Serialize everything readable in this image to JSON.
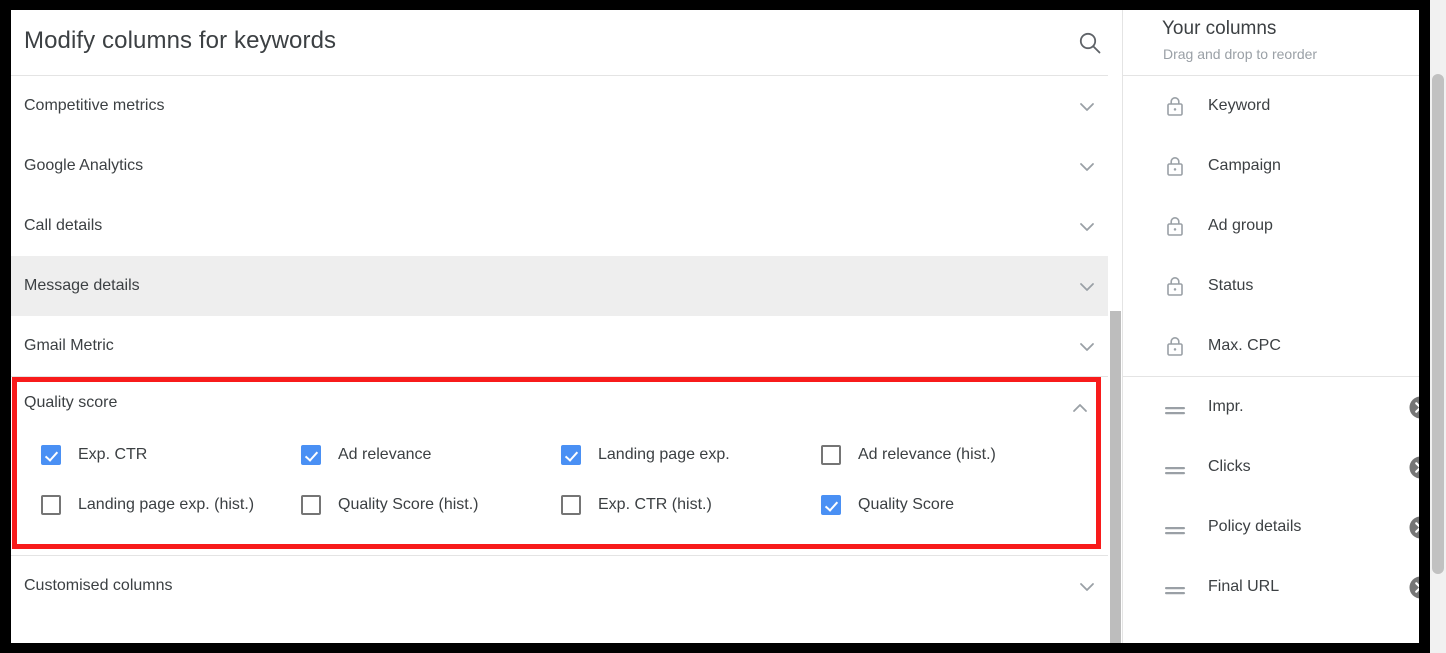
{
  "dialog": {
    "title": "Modify columns for keywords",
    "search_icon": "search-icon"
  },
  "sections": [
    {
      "label": "Competitive metrics",
      "expanded": false,
      "hovered": false
    },
    {
      "label": "Google Analytics",
      "expanded": false,
      "hovered": false
    },
    {
      "label": "Call details",
      "expanded": false,
      "hovered": false
    },
    {
      "label": "Message details",
      "expanded": false,
      "hovered": true
    },
    {
      "label": "Gmail Metric",
      "expanded": false,
      "hovered": false
    }
  ],
  "quality_score": {
    "label": "Quality score",
    "expanded": true,
    "highlight_color": "#f81b1b",
    "rows": [
      [
        {
          "label": "Exp. CTR",
          "checked": true
        },
        {
          "label": "Ad relevance",
          "checked": true
        },
        {
          "label": "Landing page exp.",
          "checked": true
        },
        {
          "label": "Ad relevance (hist.)",
          "checked": false
        }
      ],
      [
        {
          "label": "Landing page exp. (hist.)",
          "checked": false
        },
        {
          "label": "Quality Score (hist.)",
          "checked": false
        },
        {
          "label": "Exp. CTR (hist.)",
          "checked": false
        },
        {
          "label": "Quality Score",
          "checked": true
        }
      ]
    ]
  },
  "bottom_section": {
    "label": "Customised columns",
    "expanded": false
  },
  "your_columns": {
    "title": "Your columns",
    "subtitle": "Drag and drop to reorder",
    "locked": [
      {
        "label": "Keyword"
      },
      {
        "label": "Campaign"
      },
      {
        "label": "Ad group"
      },
      {
        "label": "Status"
      },
      {
        "label": "Max. CPC"
      }
    ],
    "draggable": [
      {
        "label": "Impr."
      },
      {
        "label": "Clicks"
      },
      {
        "label": "Policy details"
      },
      {
        "label": "Final URL"
      }
    ]
  },
  "colors": {
    "accent_blue": "#4a90f4",
    "text": "#3c4043",
    "muted": "#9aa0a6",
    "divider": "#e4e4e4",
    "highlight": "#f81b1b"
  }
}
